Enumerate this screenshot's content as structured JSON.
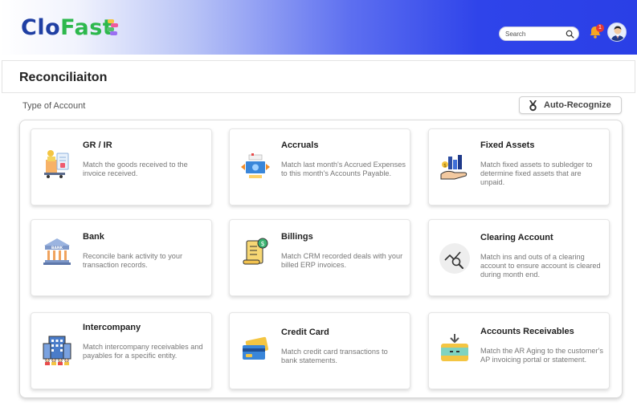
{
  "app": {
    "logo_part1": "Clo",
    "logo_part2": "Fast",
    "brand_blue": "#2a3fe6",
    "brand_green": "#2db84d"
  },
  "header": {
    "search_placeholder": "Search",
    "notification_count": "1"
  },
  "page": {
    "title": "Reconciliaiton",
    "section_label": "Type of Account",
    "auto_recognize_label": "Auto-Recognize"
  },
  "cards": [
    {
      "title": "GR / IR",
      "description": "Match the goods received to the invoice received.",
      "icon": "goods-receipt-icon"
    },
    {
      "title": "Accruals",
      "description": "Match last month's Accrued Expenses to this month's Accounts Payable.",
      "icon": "money-transfer-icon"
    },
    {
      "title": "Fixed Assets",
      "description": "Match fixed assets to subledger to determine fixed assets that are unpaid.",
      "icon": "assets-hand-icon"
    },
    {
      "title": "Bank",
      "description": "Reconcile bank activity to your transaction records.",
      "icon": "bank-icon"
    },
    {
      "title": "Billings",
      "description": "Match CRM recorded deals with your billed ERP invoices.",
      "icon": "billing-scroll-icon"
    },
    {
      "title": "Clearing Account",
      "description": "Match ins and outs of a clearing account to ensure account is cleared during month end.",
      "icon": "magnify-chart-icon"
    },
    {
      "title": "Intercompany",
      "description": "Match intercompany receivables and payables for a specific entity.",
      "icon": "office-building-icon"
    },
    {
      "title": "Credit Card",
      "description": "Match credit card transactions to bank statements.",
      "icon": "credit-card-icon"
    },
    {
      "title": "Accounts Receivables",
      "description": "Match the AR Aging to the customer's AP invoicing portal or statement.",
      "icon": "wallet-download-icon"
    }
  ]
}
